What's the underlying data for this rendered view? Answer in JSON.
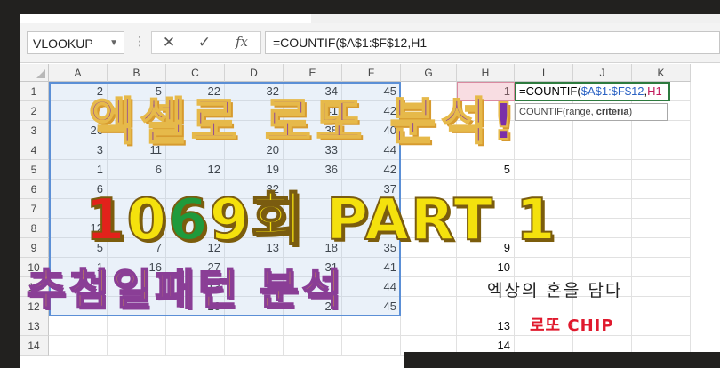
{
  "formula_bar": {
    "name_box": "VLOOKUP",
    "cancel_icon": "✕",
    "enter_icon": "✓",
    "fx_label": "fx",
    "formula": "=COUNTIF($A$1:$F$12,H1"
  },
  "columns": [
    "A",
    "B",
    "C",
    "D",
    "E",
    "F",
    "G",
    "H",
    "I",
    "J",
    "K"
  ],
  "rows": [
    "1",
    "2",
    "3",
    "4",
    "5",
    "6",
    "7",
    "8",
    "9",
    "10",
    "11",
    "12",
    "13",
    "14"
  ],
  "data_cells": {
    "r1": [
      "2",
      "5",
      "22",
      "32",
      "34",
      "45"
    ],
    "r2": [
      "",
      "14",
      "",
      "",
      "41",
      "42"
    ],
    "r3": [
      "26",
      "31",
      "",
      "",
      "38",
      "40"
    ],
    "r4": [
      "3",
      "11",
      "",
      "20",
      "33",
      "44"
    ],
    "r5": [
      "1",
      "6",
      "12",
      "19",
      "36",
      "42"
    ],
    "r6": [
      "6",
      "",
      "",
      "32",
      "",
      "37"
    ],
    "r7": [
      "",
      "5",
      "",
      "",
      "",
      "36"
    ],
    "r8": [
      "12",
      "",
      "",
      "37",
      "",
      "40"
    ],
    "r9": [
      "5",
      "7",
      "12",
      "13",
      "18",
      "35"
    ],
    "r10": [
      "1",
      "16",
      "27",
      "",
      "31",
      "41"
    ],
    "r11": [
      "",
      "",
      "13",
      "",
      "",
      "44"
    ],
    "r12": [
      "",
      "",
      "20",
      "",
      "29",
      "45"
    ]
  },
  "column_h": [
    "1",
    "",
    "",
    "",
    "5",
    "",
    "",
    "",
    "9",
    "10",
    "",
    "",
    "13",
    "14"
  ],
  "active_cell": {
    "prefix": "=COUNTIF(",
    "range": "$A$1:$F$12",
    "comma": ",",
    "ref": "H1"
  },
  "tooltip": {
    "text_start": "COUNTIF(range, ",
    "text_bold": "criteria",
    "text_end": ")"
  },
  "overlay": {
    "title_line1": "엑셀로 로또 분석!",
    "title_line2_d1": "1",
    "title_line2_d2": "0",
    "title_line2_d3": "6",
    "title_line2_d4": "9",
    "title_line2_rest": "회 PART 1",
    "title_line3": "추첨일패턴 분석",
    "slogan": "엑상의 혼을 담다",
    "brand": "로또 CHIP"
  },
  "colors": {
    "range_border": "#5b8fd6",
    "active_border": "#2d7a3e",
    "title_purple": "#7b2fa8",
    "title_yellow": "#f4e10d",
    "brand_red": "#e0192d"
  }
}
